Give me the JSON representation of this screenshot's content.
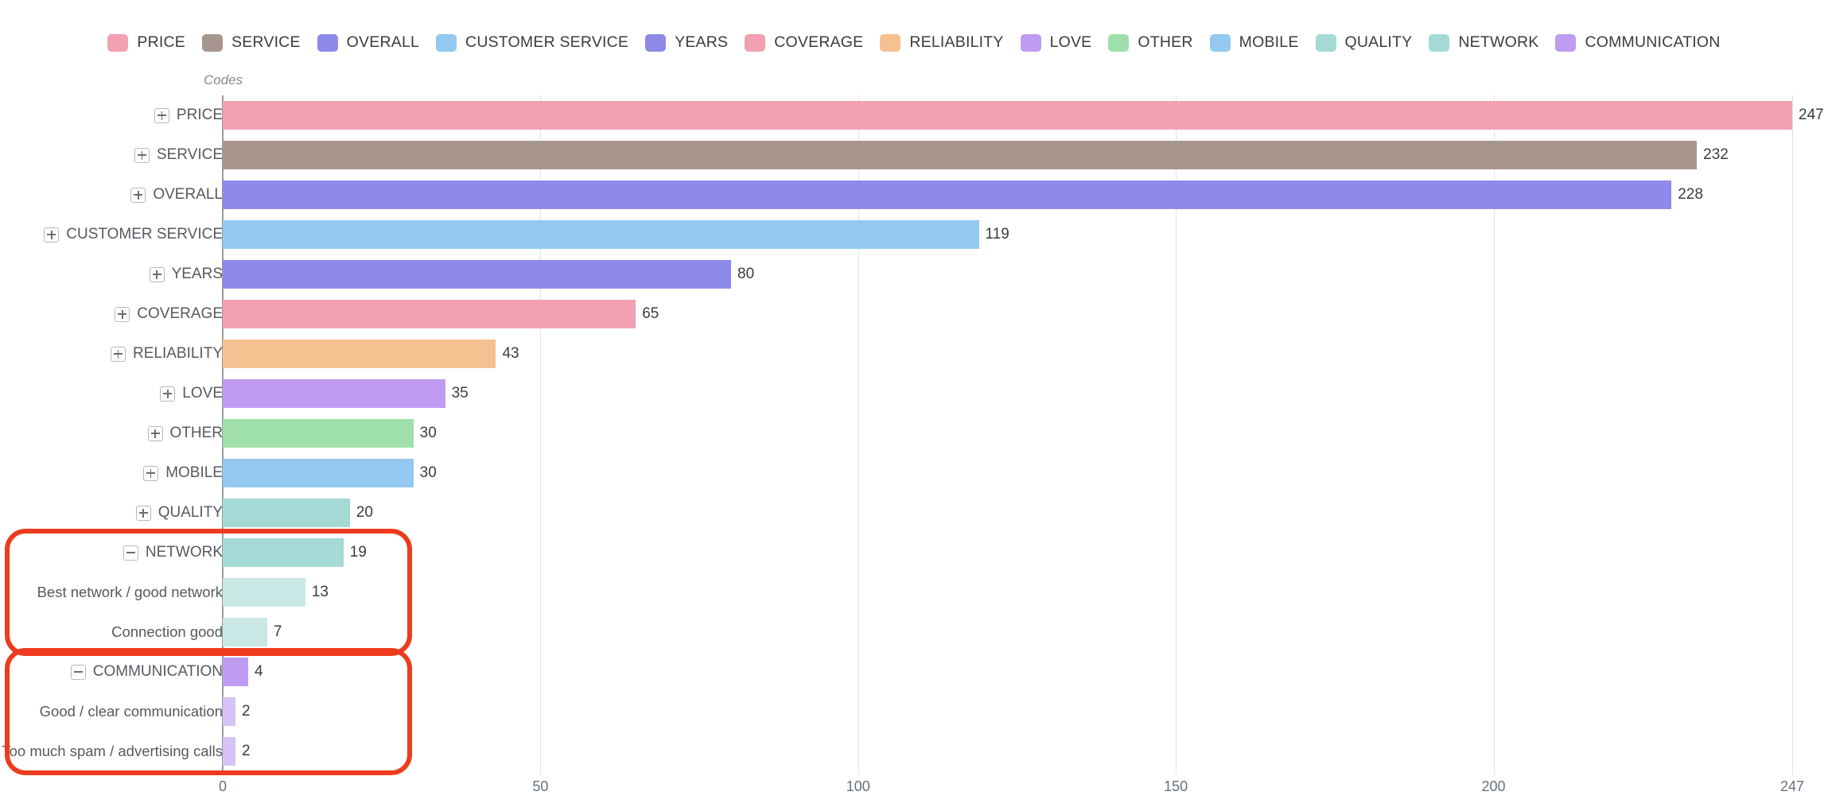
{
  "axis_title": "Codes",
  "legend": {
    "position": "top-center",
    "items": [
      {
        "label": "PRICE",
        "color": "#f2a0b2"
      },
      {
        "label": "SERVICE",
        "color": "#a8968e"
      },
      {
        "label": "OVERALL",
        "color": "#8d8aea"
      },
      {
        "label": "CUSTOMER SERVICE",
        "color": "#93c8f0"
      },
      {
        "label": "YEARS",
        "color": "#8d8aea"
      },
      {
        "label": "COVERAGE",
        "color": "#f2a0b2"
      },
      {
        "label": "RELIABILITY",
        "color": "#f5c191"
      },
      {
        "label": "LOVE",
        "color": "#bf9bf2"
      },
      {
        "label": "OTHER",
        "color": "#9fdfab"
      },
      {
        "label": "MOBILE",
        "color": "#93c8f0"
      },
      {
        "label": "QUALITY",
        "color": "#a5d9d5"
      },
      {
        "label": "NETWORK",
        "color": "#a5d9d5"
      },
      {
        "label": "COMMUNICATION",
        "color": "#bf9bf2"
      }
    ]
  },
  "chart_data": {
    "type": "bar",
    "orientation": "horizontal",
    "title": "",
    "xlabel": "",
    "ylabel": "Codes",
    "xlim": [
      0,
      247
    ],
    "grid": true,
    "xticks": [
      0,
      50,
      100,
      150,
      200,
      247
    ],
    "xtick_labels": [
      "0",
      "50",
      "100",
      "150",
      "200",
      "247"
    ],
    "categories": [
      "PRICE",
      "SERVICE",
      "OVERALL",
      "CUSTOMER SERVICE",
      "YEARS",
      "COVERAGE",
      "RELIABILITY",
      "LOVE",
      "OTHER",
      "MOBILE",
      "QUALITY",
      "NETWORK",
      "Best network / good network",
      "Connection good",
      "COMMUNICATION",
      "Good / clear communication",
      "Too much spam / advertising calls"
    ],
    "values": [
      247,
      232,
      228,
      119,
      80,
      65,
      43,
      35,
      30,
      30,
      20,
      19,
      13,
      7,
      4,
      2,
      2
    ],
    "rows": [
      {
        "label": "PRICE",
        "value": 247,
        "value_text": "247",
        "color": "#f2a0b2",
        "level": 0,
        "toggle": "plus",
        "highlighted": false
      },
      {
        "label": "SERVICE",
        "value": 232,
        "value_text": "232",
        "color": "#a8968e",
        "level": 0,
        "toggle": "plus",
        "highlighted": false
      },
      {
        "label": "OVERALL",
        "value": 228,
        "value_text": "228",
        "color": "#8d8aea",
        "level": 0,
        "toggle": "plus",
        "highlighted": false
      },
      {
        "label": "CUSTOMER SERVICE",
        "value": 119,
        "value_text": "119",
        "color": "#93c8f0",
        "level": 0,
        "toggle": "plus",
        "highlighted": false
      },
      {
        "label": "YEARS",
        "value": 80,
        "value_text": "80",
        "color": "#8d8aea",
        "level": 0,
        "toggle": "plus",
        "highlighted": false
      },
      {
        "label": "COVERAGE",
        "value": 65,
        "value_text": "65",
        "color": "#f2a0b2",
        "level": 0,
        "toggle": "plus",
        "highlighted": false
      },
      {
        "label": "RELIABILITY",
        "value": 43,
        "value_text": "43",
        "color": "#f5c191",
        "level": 0,
        "toggle": "plus",
        "highlighted": false
      },
      {
        "label": "LOVE",
        "value": 35,
        "value_text": "35",
        "color": "#bf9bf2",
        "level": 0,
        "toggle": "plus",
        "highlighted": false
      },
      {
        "label": "OTHER",
        "value": 30,
        "value_text": "30",
        "color": "#9fdfab",
        "level": 0,
        "toggle": "plus",
        "highlighted": false
      },
      {
        "label": "MOBILE",
        "value": 30,
        "value_text": "30",
        "color": "#93c8f0",
        "level": 0,
        "toggle": "plus",
        "highlighted": false
      },
      {
        "label": "QUALITY",
        "value": 20,
        "value_text": "20",
        "color": "#a5d9d5",
        "level": 0,
        "toggle": "plus",
        "highlighted": false
      },
      {
        "label": "NETWORK",
        "value": 19,
        "value_text": "19",
        "color": "#a5d9d5",
        "level": 0,
        "toggle": "minus",
        "highlighted": true
      },
      {
        "label": "Best network / good network",
        "value": 13,
        "value_text": "13",
        "color": "#c9e7e5",
        "level": 1,
        "toggle": "none",
        "highlighted": true
      },
      {
        "label": "Connection good",
        "value": 7,
        "value_text": "7",
        "color": "#c9e7e5",
        "level": 1,
        "toggle": "none",
        "highlighted": true
      },
      {
        "label": "COMMUNICATION",
        "value": 4,
        "value_text": "4",
        "color": "#bf9bf2",
        "level": 0,
        "toggle": "minus",
        "highlighted": true
      },
      {
        "label": "Good / clear communication",
        "value": 2,
        "value_text": "2",
        "color": "#d7c3f7",
        "level": 1,
        "toggle": "none",
        "highlighted": true
      },
      {
        "label": "Too much spam / advertising calls",
        "value": 2,
        "value_text": "2",
        "color": "#d7c3f7",
        "level": 1,
        "toggle": "none",
        "highlighted": true
      }
    ],
    "annotations": [
      {
        "name": "network-group-highlight",
        "shape": "rounded-rect",
        "color": "#ee3b1e",
        "covers": [
          "NETWORK",
          "Best network / good network",
          "Connection good"
        ]
      },
      {
        "name": "communication-group-highlight",
        "shape": "rounded-rect",
        "color": "#ee3b1e",
        "covers": [
          "COMMUNICATION",
          "Good / clear communication",
          "Too much spam / advertising calls"
        ]
      }
    ]
  }
}
